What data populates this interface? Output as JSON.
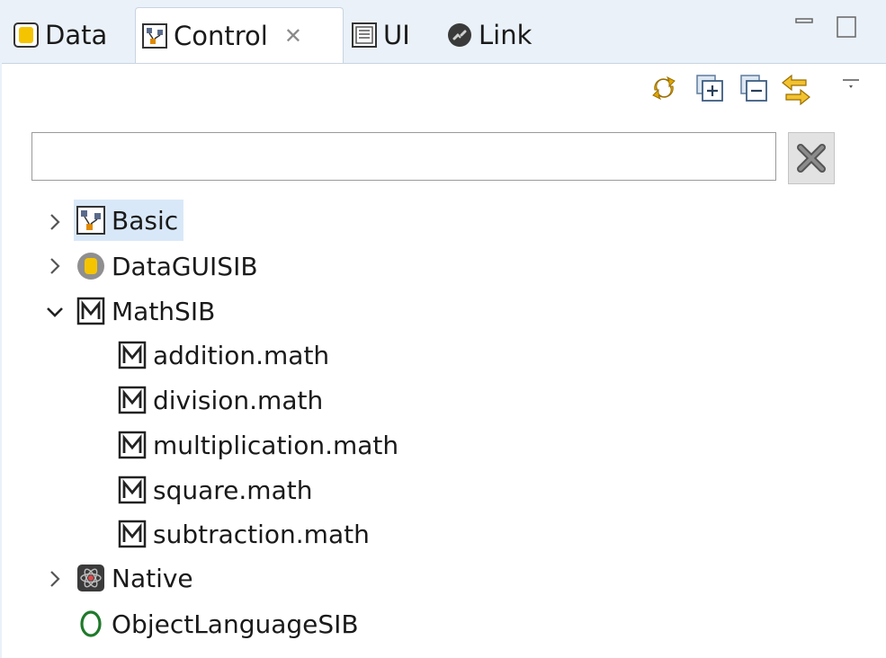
{
  "tabs": [
    {
      "label": "Data",
      "icon": "data-cylinder-icon",
      "active": false
    },
    {
      "label": "Control",
      "icon": "control-graph-icon",
      "active": true,
      "close_glyph": "✕"
    },
    {
      "label": "UI",
      "icon": "ui-form-icon",
      "active": false
    },
    {
      "label": "Link",
      "icon": "link-chain-icon",
      "active": false
    }
  ],
  "search": {
    "value": "",
    "placeholder": ""
  },
  "toolbar": {
    "icons": [
      "sync-icon",
      "expand-all-icon",
      "collapse-all-icon",
      "link-with-editor-icon",
      "view-menu-icon"
    ]
  },
  "tree": {
    "items": [
      {
        "label": "Basic",
        "icon": "control-graph-icon",
        "expanded": false,
        "selected": true
      },
      {
        "label": "DataGUISIB",
        "icon": "data-cylinder-icon",
        "expanded": false
      },
      {
        "label": "MathSIB",
        "icon": "math-m-icon",
        "expanded": true,
        "children": [
          {
            "label": "addition.math",
            "icon": "math-m-icon"
          },
          {
            "label": "division.math",
            "icon": "math-m-icon"
          },
          {
            "label": "multiplication.math",
            "icon": "math-m-icon"
          },
          {
            "label": "square.math",
            "icon": "math-m-icon"
          },
          {
            "label": "subtraction.math",
            "icon": "math-m-icon"
          }
        ]
      },
      {
        "label": "Native",
        "icon": "native-atom-icon",
        "expanded": false
      },
      {
        "label": "ObjectLanguageSIB",
        "icon": "object-o-icon",
        "expanded": null
      }
    ]
  },
  "colors": {
    "tabbar_bg": "#eaf1f9",
    "selection": "#d9e8f8",
    "toolbar_accent": "#d9a400",
    "object_icon": "#1f7a2a"
  }
}
